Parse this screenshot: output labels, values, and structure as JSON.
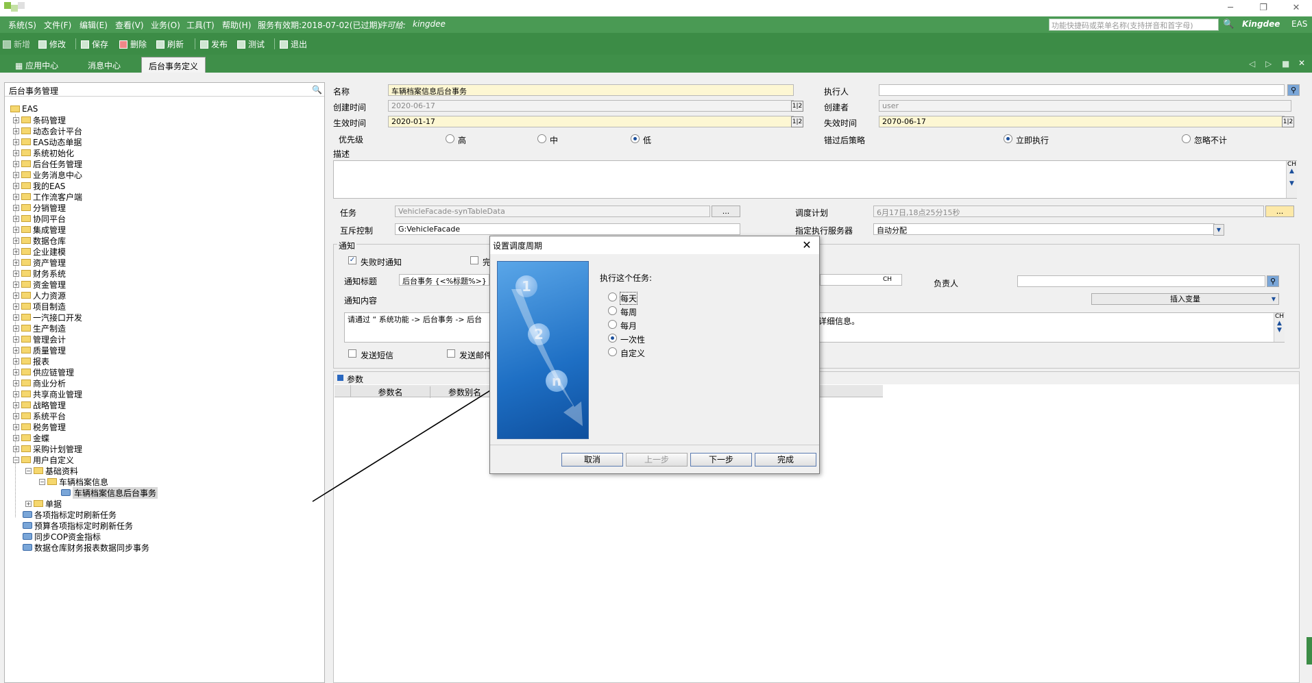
{
  "window": {
    "controls": [
      "─",
      "❐",
      "✕"
    ]
  },
  "menubar": {
    "items": [
      "系统(S)",
      "文件(F)",
      "编辑(E)",
      "查看(V)",
      "业务(O)",
      "工具(T)",
      "帮助(H)"
    ],
    "service_label": "服务有效期:2018-07-02(已过期)",
    "license_label": "许可给:",
    "licensee": "kingdee",
    "search_placeholder": "功能快捷码或菜单名称(支持拼音和首字母)",
    "brand": "Kingdee",
    "product": "EAS"
  },
  "toolbar": {
    "new": "新增",
    "edit": "修改",
    "save": "保存",
    "delete": "删除",
    "refresh": "刷新",
    "publish": "发布",
    "test": "测试",
    "exit": "退出"
  },
  "tabs": [
    "应用中心",
    "消息中心",
    "后台事务定义"
  ],
  "tree": {
    "title": "后台事务管理",
    "root": "EAS",
    "items": [
      "条码管理",
      "动态会计平台",
      "EAS动态单据",
      "系统初始化",
      "后台任务管理",
      "业务消息中心",
      "我的EAS",
      "工作流客户端",
      "分销管理",
      "协同平台",
      "集成管理",
      "数据仓库",
      "企业建模",
      "资产管理",
      "财务系统",
      "资金管理",
      "人力资源",
      "项目制造",
      "一汽接口开发",
      "生产制造",
      "管理会计",
      "质量管理",
      "报表",
      "供应链管理",
      "商业分析",
      "共享商业管理",
      "战略管理",
      "系统平台",
      "税务管理",
      "金蝶",
      "采购计划管理",
      "用户自定义"
    ],
    "user_children": {
      "basic": "基础资料",
      "vehicle": "车辆档案信息",
      "selected": "车辆档案信息后台事务",
      "bills": "单据"
    },
    "jobs": [
      "各项指标定时刷新任务",
      "预算各项指标定时刷新任务",
      "同步COP资金指标",
      "数据仓库财务报表数据同步事务"
    ]
  },
  "form": {
    "name_label": "名称",
    "name_value": "车辆档案信息后台事务",
    "executor_label": "执行人",
    "executor_value": "",
    "created_time_label": "创建时间",
    "created_time_value": "2020-06-17",
    "creator_label": "创建者",
    "creator_value": "user",
    "effective_label": "生效时间",
    "effective_value": "2020-01-17",
    "expire_label": "失效时间",
    "expire_value": "2070-06-17",
    "priority_label": "优先级",
    "priority_high": "高",
    "priority_mid": "中",
    "priority_low": "低",
    "miss_strategy_label": "错过后策略",
    "miss_now": "立即执行",
    "miss_ignore": "忽略不计",
    "desc_label": "描述",
    "ch": "CH",
    "task_label": "任务",
    "task_value": "VehicleFacade-synTableData",
    "schedule_label": "调度计划",
    "schedule_value": "6月17日,18点25分15秒",
    "mutex_label": "互斥控制",
    "mutex_value": "G:VehicleFacade",
    "server_label": "指定执行服务器",
    "server_value": "自动分配",
    "ellipsis": "..."
  },
  "notify": {
    "group": "通知",
    "on_fail": "失败时通知",
    "on_done_partial": "完",
    "title_label": "通知标题",
    "title_value": "后台事务 {<%标题%>}",
    "owner_label": "负责人",
    "insert_var": "插入变量",
    "content_label": "通知内容",
    "content_left": "请通过 “ 系统功能 -> 后台事务 -> 后台",
    "content_right": "看详细信息。",
    "sms": "发送短信",
    "mail_partial": "发送邮件"
  },
  "params": {
    "group": "参数",
    "col_name": "参数名",
    "col_alias": "参数别名"
  },
  "dialog": {
    "title": "设置调度周期",
    "prompt": "执行这个任务:",
    "options": [
      "每天",
      "每周",
      "每月",
      "一次性",
      "自定义"
    ],
    "selected": "一次性",
    "buttons": {
      "cancel": "取消",
      "prev": "上一步",
      "next": "下一步",
      "finish": "完成"
    },
    "badges": [
      "1",
      "2",
      "n"
    ]
  }
}
